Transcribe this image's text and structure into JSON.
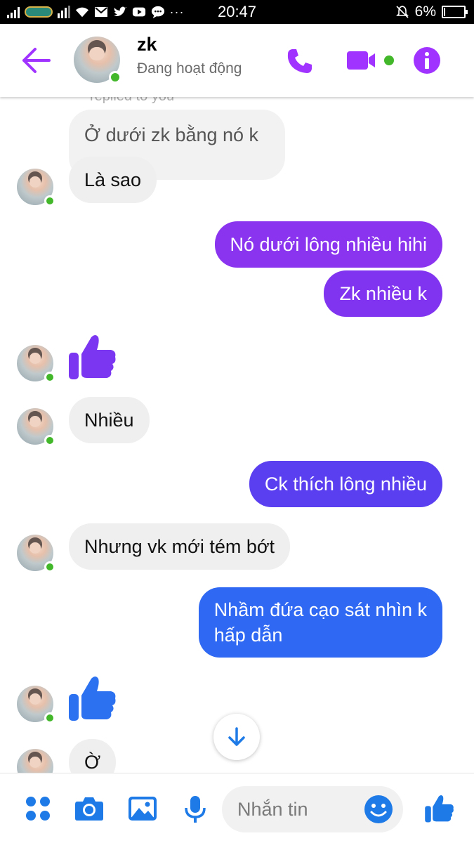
{
  "status_bar": {
    "time": "20:47",
    "battery": "6%",
    "battery_level": 0.06
  },
  "header": {
    "contact_name": "zk",
    "contact_status": "Đang hoạt động",
    "accent_color": "#a033ff"
  },
  "thread": {
    "reply_note": "replied to you",
    "quoted_text": "Ở dưới zk bằng nó k",
    "messages": [
      {
        "id": "m1",
        "sender": "them",
        "text": "Là sao"
      },
      {
        "id": "m2",
        "sender": "me",
        "text": "Nó dưới lông nhiều hihi",
        "color": "#8a34ef"
      },
      {
        "id": "m3",
        "sender": "me",
        "text": "Zk nhiều k",
        "color": "#8034ef"
      },
      {
        "id": "m4",
        "sender": "them",
        "type": "like",
        "color": "#7a36f0"
      },
      {
        "id": "m5",
        "sender": "them",
        "text": "Nhiều"
      },
      {
        "id": "m6",
        "sender": "me",
        "text": "Ck thích lông nhiều",
        "color": "#5a3ff0"
      },
      {
        "id": "m7",
        "sender": "them",
        "text": "Nhưng vk mới tém bớt"
      },
      {
        "id": "m8",
        "sender": "me",
        "text_line1": "Nhầm đứa cạo sát nhìn k",
        "text_line2": "hấp dẫn",
        "color": "#2f68f2"
      },
      {
        "id": "m9",
        "sender": "them",
        "type": "like",
        "color": "#2b71f0"
      },
      {
        "id": "m10",
        "sender": "them",
        "text": "Ờ"
      }
    ]
  },
  "composer": {
    "placeholder": "Nhắn tin",
    "icon_color": "#1e7ae6"
  },
  "icons": {
    "back": "arrow-left-icon",
    "call": "phone-icon",
    "video": "video-camera-icon",
    "info": "info-icon",
    "scroll": "arrow-down-icon",
    "more": "four-dots-icon",
    "camera": "camera-icon",
    "gallery": "image-icon",
    "mic": "microphone-icon",
    "emoji": "smiley-icon",
    "like": "thumbs-up-icon"
  }
}
